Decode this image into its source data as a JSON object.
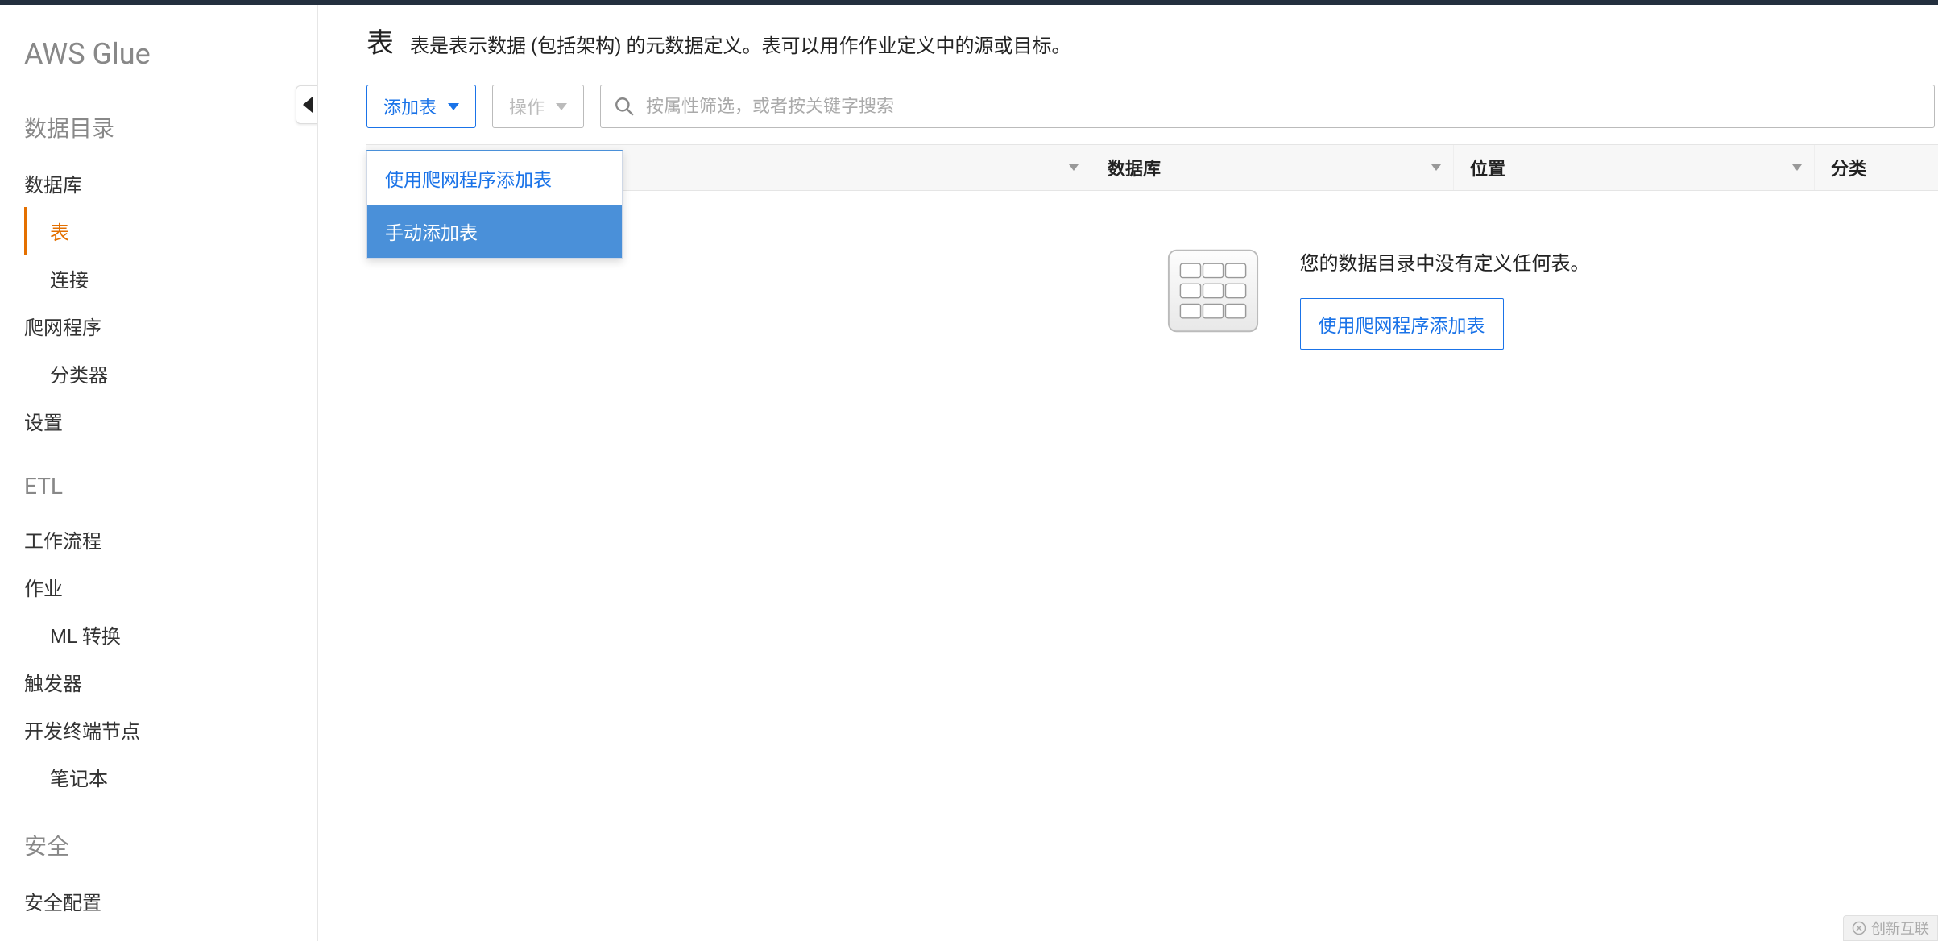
{
  "sidebar": {
    "title": "AWS Glue",
    "sections": [
      {
        "heading": "数据目录",
        "items": [
          {
            "label": "数据库",
            "indent": false,
            "selected": false
          },
          {
            "label": "表",
            "indent": true,
            "selected": true
          },
          {
            "label": "连接",
            "indent": true,
            "selected": false
          },
          {
            "label": "爬网程序",
            "indent": false,
            "selected": false
          },
          {
            "label": "分类器",
            "indent": true,
            "selected": false
          },
          {
            "label": "设置",
            "indent": false,
            "selected": false
          }
        ]
      },
      {
        "heading": "ETL",
        "items": [
          {
            "label": "工作流程",
            "indent": false,
            "selected": false
          },
          {
            "label": "作业",
            "indent": false,
            "selected": false
          },
          {
            "label": "ML 转换",
            "indent": true,
            "selected": false
          },
          {
            "label": "触发器",
            "indent": false,
            "selected": false
          },
          {
            "label": "开发终端节点",
            "indent": false,
            "selected": false
          },
          {
            "label": "笔记本",
            "indent": true,
            "selected": false
          }
        ]
      },
      {
        "heading": "安全",
        "items": [
          {
            "label": "安全配置",
            "indent": false,
            "selected": false
          }
        ]
      }
    ]
  },
  "main": {
    "title": "表",
    "description": "表是表示数据 (包括架构) 的元数据定义。表可以用作作业定义中的源或目标。",
    "toolbar": {
      "add_table_label": "添加表",
      "actions_label": "操作"
    },
    "dropdown": {
      "item_crawler": "使用爬网程序添加表",
      "item_manual": "手动添加表"
    },
    "search": {
      "placeholder": "按属性筛选，或者按关键字搜索"
    },
    "columns": {
      "database": "数据库",
      "location": "位置",
      "classification": "分类"
    },
    "empty": {
      "message": "您的数据目录中没有定义任何表。",
      "cta": "使用爬网程序添加表"
    }
  },
  "watermark": "创新互联"
}
